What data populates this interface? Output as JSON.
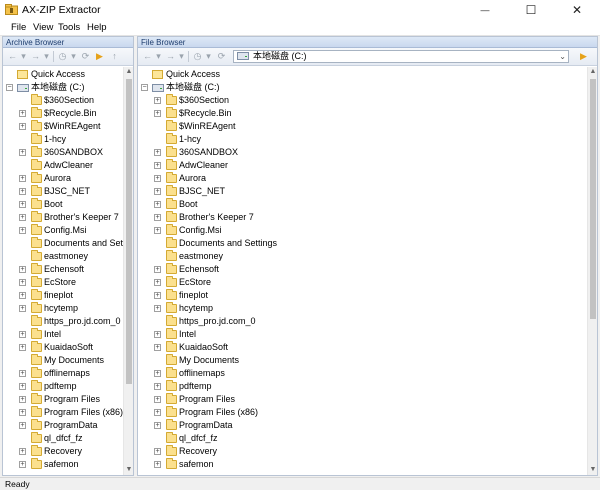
{
  "window": {
    "title": "AX-ZIP Extractor",
    "minimize_glyph": "—",
    "maximize_glyph": "☐",
    "close_glyph": "✕"
  },
  "menu": [
    "File",
    "View",
    "Tools",
    "Help"
  ],
  "archive_browser": {
    "title": "Archive Browser",
    "quick_access": "Quick Access",
    "drive_label": "本地磁盘 (C:)",
    "items": [
      {
        "label": "$360Section",
        "expandable": false
      },
      {
        "label": "$Recycle.Bin",
        "expandable": true
      },
      {
        "label": "$WinREAgent",
        "expandable": true
      },
      {
        "label": "1-hcy",
        "expandable": false
      },
      {
        "label": "360SANDBOX",
        "expandable": true
      },
      {
        "label": "AdwCleaner",
        "expandable": false
      },
      {
        "label": "Aurora",
        "expandable": true
      },
      {
        "label": "BJSC_NET",
        "expandable": true
      },
      {
        "label": "Boot",
        "expandable": true
      },
      {
        "label": "Brother's Keeper 7",
        "expandable": true
      },
      {
        "label": "Config.Msi",
        "expandable": true
      },
      {
        "label": "Documents and Settings",
        "expandable": false
      },
      {
        "label": "eastmoney",
        "expandable": false
      },
      {
        "label": "Echensoft",
        "expandable": true
      },
      {
        "label": "EcStore",
        "expandable": true
      },
      {
        "label": "fineplot",
        "expandable": true
      },
      {
        "label": "hcytemp",
        "expandable": true
      },
      {
        "label": "https_pro.jd.com_0",
        "expandable": false
      },
      {
        "label": "Intel",
        "expandable": true
      },
      {
        "label": "KuaidaoSoft",
        "expandable": true
      },
      {
        "label": "My Documents",
        "expandable": false
      },
      {
        "label": "offlinemaps",
        "expandable": true
      },
      {
        "label": "pdftemp",
        "expandable": true
      },
      {
        "label": "Program Files",
        "expandable": true
      },
      {
        "label": "Program Files (x86)",
        "expandable": true
      },
      {
        "label": "ProgramData",
        "expandable": true
      },
      {
        "label": "ql_dfcf_fz",
        "expandable": false
      },
      {
        "label": "Recovery",
        "expandable": true
      },
      {
        "label": "safemon",
        "expandable": true
      }
    ]
  },
  "file_browser": {
    "title": "File Browser",
    "path": "本地磁盘 (C:)",
    "quick_access": "Quick Access",
    "drive_label": "本地磁盘 (C:)",
    "items": [
      {
        "label": "$360Section",
        "expandable": true
      },
      {
        "label": "$Recycle.Bin",
        "expandable": true
      },
      {
        "label": "$WinREAgent",
        "expandable": false
      },
      {
        "label": "1-hcy",
        "expandable": false
      },
      {
        "label": "360SANDBOX",
        "expandable": true
      },
      {
        "label": "AdwCleaner",
        "expandable": true
      },
      {
        "label": "Aurora",
        "expandable": true
      },
      {
        "label": "BJSC_NET",
        "expandable": true
      },
      {
        "label": "Boot",
        "expandable": true
      },
      {
        "label": "Brother's Keeper 7",
        "expandable": true
      },
      {
        "label": "Config.Msi",
        "expandable": true
      },
      {
        "label": "Documents and Settings",
        "expandable": false
      },
      {
        "label": "eastmoney",
        "expandable": false
      },
      {
        "label": "Echensoft",
        "expandable": true
      },
      {
        "label": "EcStore",
        "expandable": true
      },
      {
        "label": "fineplot",
        "expandable": true
      },
      {
        "label": "hcytemp",
        "expandable": true
      },
      {
        "label": "https_pro.jd.com_0",
        "expandable": false
      },
      {
        "label": "Intel",
        "expandable": true
      },
      {
        "label": "KuaidaoSoft",
        "expandable": true
      },
      {
        "label": "My Documents",
        "expandable": false
      },
      {
        "label": "offlinemaps",
        "expandable": true
      },
      {
        "label": "pdftemp",
        "expandable": true
      },
      {
        "label": "Program Files",
        "expandable": true
      },
      {
        "label": "Program Files (x86)",
        "expandable": true
      },
      {
        "label": "ProgramData",
        "expandable": true
      },
      {
        "label": "ql_dfcf_fz",
        "expandable": false
      },
      {
        "label": "Recovery",
        "expandable": true
      },
      {
        "label": "safemon",
        "expandable": true
      }
    ]
  },
  "status": "Ready"
}
